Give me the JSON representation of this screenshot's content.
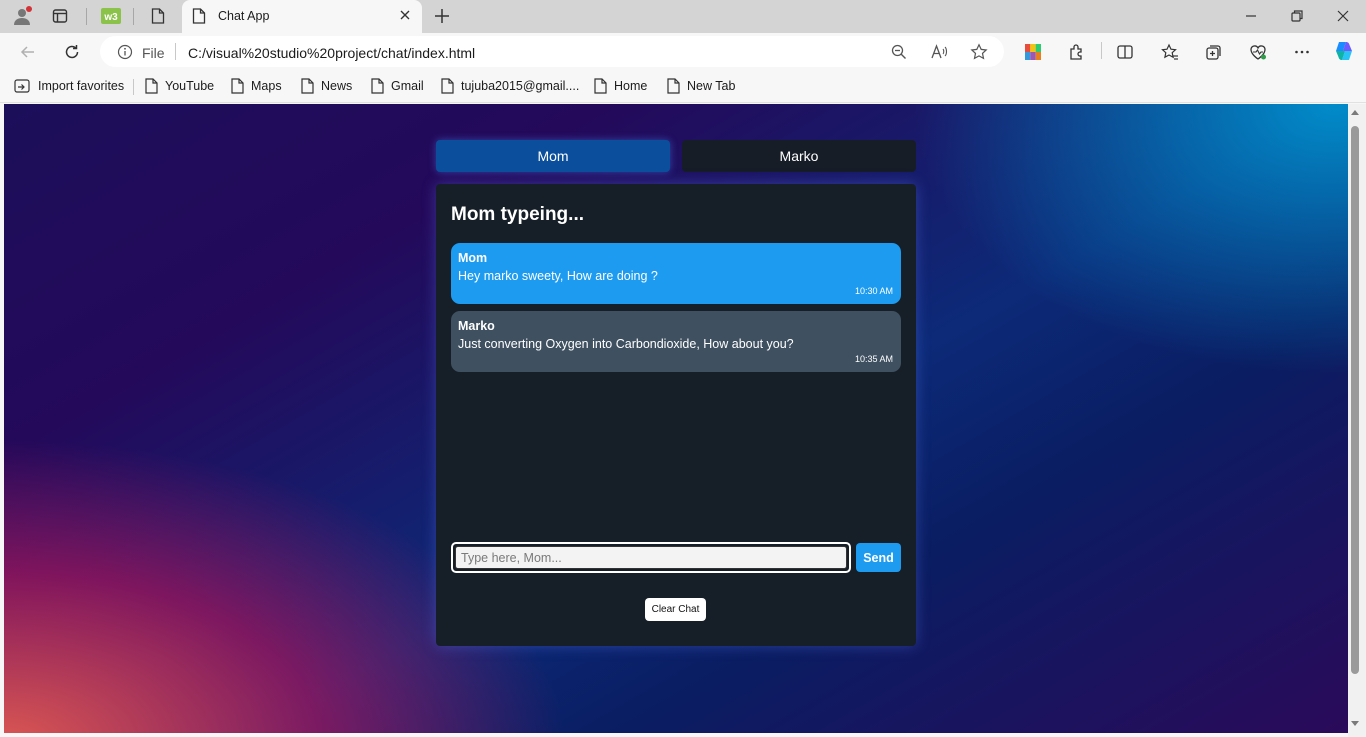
{
  "browser": {
    "active_tab_title": "Chat App",
    "address": {
      "scheme_label": "File",
      "url": "C:/visual%20studio%20project/chat/index.html"
    },
    "favorites": [
      {
        "label": "Import favorites",
        "icon": "import-favorites-icon"
      },
      {
        "label": "YouTube",
        "icon": "page-icon"
      },
      {
        "label": "Maps",
        "icon": "page-icon"
      },
      {
        "label": "News",
        "icon": "page-icon"
      },
      {
        "label": "Gmail",
        "icon": "page-icon"
      },
      {
        "label": "tujuba2015@gmail....",
        "icon": "page-icon"
      },
      {
        "label": "Home",
        "icon": "page-icon"
      },
      {
        "label": "New Tab",
        "icon": "page-icon"
      }
    ]
  },
  "chat": {
    "tabs": [
      {
        "label": "Mom",
        "active": true
      },
      {
        "label": "Marko",
        "active": false
      }
    ],
    "typing_indicator": "Mom typeing...",
    "messages": [
      {
        "sender": "Mom",
        "text": "Hey marko sweety, How are doing ?",
        "time": "10:30 AM"
      },
      {
        "sender": "Marko",
        "text": "Just converting Oxygen into Carbondioxide, How about you?",
        "time": "10:35 AM"
      }
    ],
    "input_placeholder": "Type here, Mom...",
    "send_label": "Send",
    "clear_label": "Clear Chat"
  },
  "colors": {
    "accent": "#1d9bf0",
    "active_tab": "#0b4f9c",
    "panel": "#161f28",
    "other_bubble": "#3f5061"
  }
}
